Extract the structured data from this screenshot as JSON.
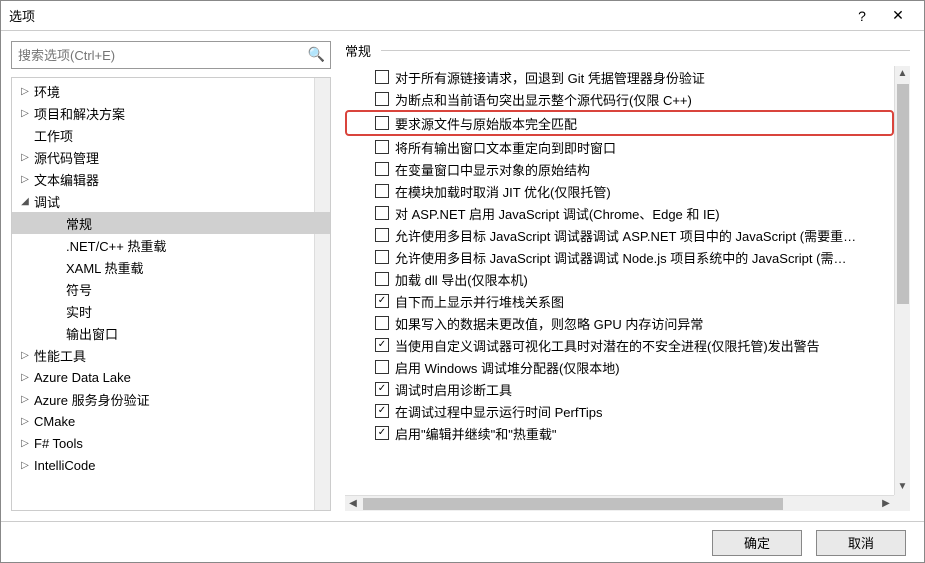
{
  "titlebar": {
    "title": "选项",
    "help": "?",
    "close": "✕"
  },
  "search": {
    "placeholder": "搜索选项(Ctrl+E)"
  },
  "tree": {
    "items": [
      {
        "label": "环境",
        "expander": "▷",
        "child": false
      },
      {
        "label": "项目和解决方案",
        "expander": "▷",
        "child": false
      },
      {
        "label": "工作项",
        "expander": "",
        "child": false
      },
      {
        "label": "源代码管理",
        "expander": "▷",
        "child": false
      },
      {
        "label": "文本编辑器",
        "expander": "▷",
        "child": false
      },
      {
        "label": "调试",
        "expander": "◢",
        "child": false
      },
      {
        "label": "常规",
        "expander": "",
        "child": true,
        "selected": true
      },
      {
        "label": ".NET/C++ 热重载",
        "expander": "",
        "child": true
      },
      {
        "label": "XAML 热重载",
        "expander": "",
        "child": true
      },
      {
        "label": "符号",
        "expander": "",
        "child": true
      },
      {
        "label": "实时",
        "expander": "",
        "child": true
      },
      {
        "label": "输出窗口",
        "expander": "",
        "child": true
      },
      {
        "label": "性能工具",
        "expander": "▷",
        "child": false
      },
      {
        "label": "Azure Data Lake",
        "expander": "▷",
        "child": false
      },
      {
        "label": "Azure 服务身份验证",
        "expander": "▷",
        "child": false
      },
      {
        "label": "CMake",
        "expander": "▷",
        "child": false
      },
      {
        "label": "F# Tools",
        "expander": "▷",
        "child": false
      },
      {
        "label": "IntelliCode",
        "expander": "▷",
        "child": false
      }
    ]
  },
  "section": {
    "title": "常规"
  },
  "options": [
    {
      "checked": false,
      "label": "对于所有源链接请求，回退到 Git 凭据管理器身份验证",
      "highlighted": false
    },
    {
      "checked": false,
      "label": "为断点和当前语句突出显示整个源代码行(仅限 C++)",
      "highlighted": false
    },
    {
      "checked": false,
      "label": "要求源文件与原始版本完全匹配",
      "highlighted": true
    },
    {
      "checked": false,
      "label": "将所有输出窗口文本重定向到即时窗口",
      "highlighted": false
    },
    {
      "checked": false,
      "label": "在变量窗口中显示对象的原始结构",
      "highlighted": false
    },
    {
      "checked": false,
      "label": "在模块加载时取消 JIT 优化(仅限托管)",
      "highlighted": false
    },
    {
      "checked": false,
      "label": "对 ASP.NET 启用 JavaScript 调试(Chrome、Edge 和 IE)",
      "highlighted": false
    },
    {
      "checked": false,
      "label": "允许使用多目标 JavaScript 调试器调试 ASP.NET 项目中的 JavaScript (需要重…",
      "highlighted": false
    },
    {
      "checked": false,
      "label": "允许使用多目标 JavaScript 调试器调试 Node.js 项目系统中的 JavaScript (需…",
      "highlighted": false
    },
    {
      "checked": false,
      "label": "加载 dll 导出(仅限本机)",
      "highlighted": false
    },
    {
      "checked": true,
      "label": "自下而上显示并行堆栈关系图",
      "highlighted": false
    },
    {
      "checked": false,
      "label": "如果写入的数据未更改值，则忽略 GPU 内存访问异常",
      "highlighted": false
    },
    {
      "checked": true,
      "label": "当使用自定义调试器可视化工具时对潜在的不安全进程(仅限托管)发出警告",
      "highlighted": false
    },
    {
      "checked": false,
      "label": "启用 Windows 调试堆分配器(仅限本地)",
      "highlighted": false
    },
    {
      "checked": true,
      "label": "调试时启用诊断工具",
      "highlighted": false
    },
    {
      "checked": true,
      "label": "在调试过程中显示运行时间 PerfTips",
      "highlighted": false
    },
    {
      "checked": true,
      "label": "启用\"编辑并继续\"和\"热重载\"",
      "highlighted": false
    }
  ],
  "footer": {
    "ok": "确定",
    "cancel": "取消"
  }
}
